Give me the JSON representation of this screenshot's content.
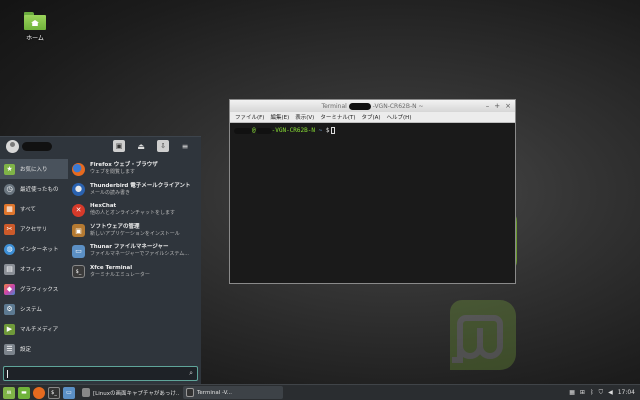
{
  "desktop": {
    "home_label": "ホーム"
  },
  "terminal": {
    "title_prefix": "Terminal",
    "title_suffix": "-VGN-CR62B-N ~",
    "menu": [
      "ファイル(F)",
      "編集(E)",
      "表示(V)",
      "ターミナル(T)",
      "タブ(A)",
      "ヘルプ(H)"
    ],
    "prompt_user": "@",
    "prompt_host": "-VGN-CR62B-N",
    "prompt_path": "~",
    "prompt_symbol": "$"
  },
  "menu": {
    "categories": [
      {
        "label": "お気に入り",
        "icon": "star-icon",
        "color": "#7fb347"
      },
      {
        "label": "最近使ったもの",
        "icon": "clock-icon",
        "color": "#6b7680"
      },
      {
        "label": "すべて",
        "icon": "grid-icon",
        "color": "#e0762c"
      },
      {
        "label": "アクセサリ",
        "icon": "tools-icon",
        "color": "#cc5a2a"
      },
      {
        "label": "インターネット",
        "icon": "globe-icon",
        "color": "#3d8fd6"
      },
      {
        "label": "オフィス",
        "icon": "office-icon",
        "color": "#8a8f96"
      },
      {
        "label": "グラフィックス",
        "icon": "palette-icon",
        "color": "#c84fa0"
      },
      {
        "label": "システム",
        "icon": "system-icon",
        "color": "#5d7a92"
      },
      {
        "label": "マルチメディア",
        "icon": "film-icon",
        "color": "#6f9a3a"
      },
      {
        "label": "設定",
        "icon": "settings-icon",
        "color": "#7c848c"
      }
    ],
    "apps": [
      {
        "name": "Firefox ウェブ・ブラウザ",
        "desc": "ウェブを閲覧します",
        "icon": "firefox-icon",
        "color": "#e66a1f"
      },
      {
        "name": "Thunderbird 電子メールクライアント",
        "desc": "メールの読み書き",
        "icon": "thunderbird-icon",
        "color": "#2a62b0"
      },
      {
        "name": "HexChat",
        "desc": "他の人とオンラインチャットをします",
        "icon": "hexchat-icon",
        "color": "#d63a2a"
      },
      {
        "name": "ソフトウェアの管理",
        "desc": "新しいアプリケーションをインストール",
        "icon": "package-icon",
        "color": "#b57a32"
      },
      {
        "name": "Thunar ファイルマネージャー",
        "desc": "ファイルマネージャーでファイルシステム...",
        "icon": "folder-icon",
        "color": "#5b8fc4"
      },
      {
        "name": "Xfce Terminal",
        "desc": "ターミナルエミュレーター",
        "icon": "terminal-icon",
        "color": "#3a3a3a"
      }
    ],
    "top_icons": [
      "display-settings-icon",
      "lock-icon",
      "logout-icon",
      "menu-icon"
    ],
    "search_placeholder": ""
  },
  "taskbar": {
    "tasks": [
      {
        "label": "[Linuxの画面キャプチャがあっけ...",
        "icon": "document-icon"
      },
      {
        "label": "Terminal -V...",
        "icon": "terminal-icon"
      }
    ],
    "clock": "17:04"
  }
}
